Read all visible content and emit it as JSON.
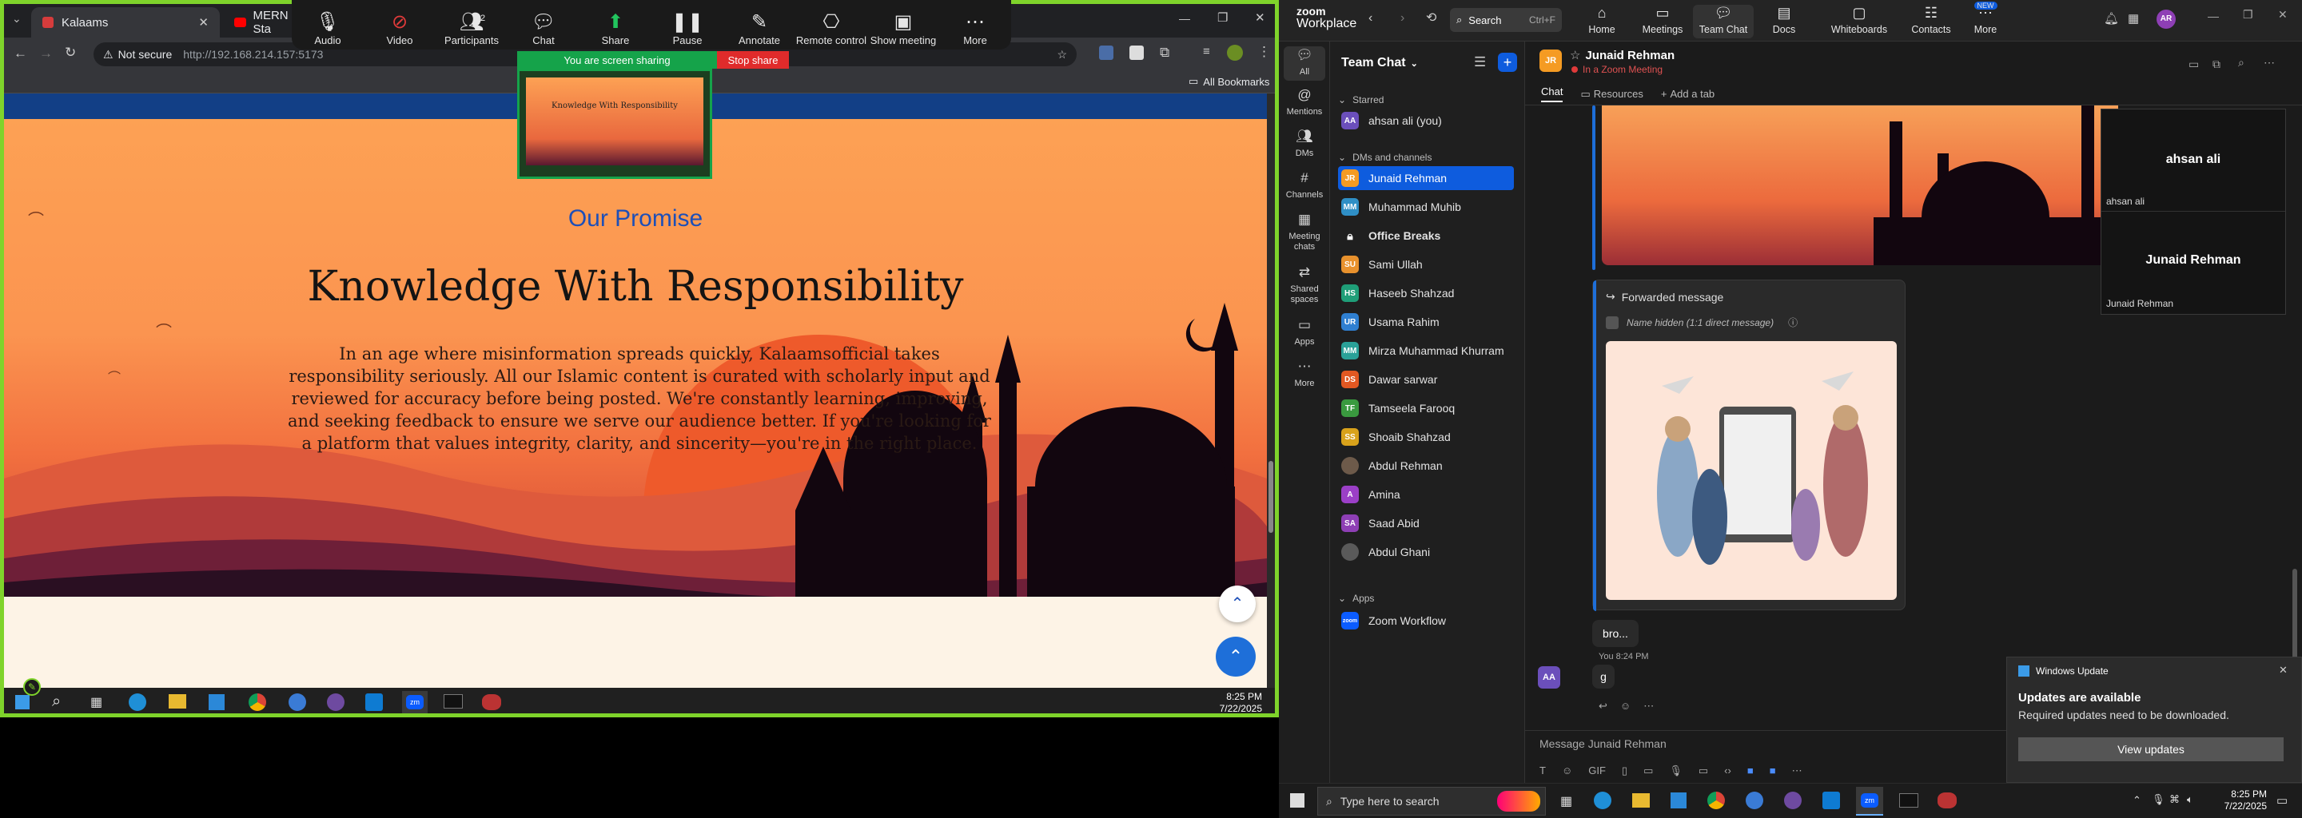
{
  "left_screen": {
    "browser": {
      "tabs": [
        {
          "label": "Kalaams",
          "active": true
        },
        {
          "label": "MERN Sta",
          "active": false
        }
      ],
      "security_label": "Not secure",
      "url": "http://192.168.214.157:5173",
      "bookmarks_label": "All Bookmarks"
    },
    "zoom_toolbar": {
      "participants_count": "2",
      "items": [
        {
          "label": "Audio",
          "icon": "microphone-icon"
        },
        {
          "label": "Video",
          "icon": "video-off-icon"
        },
        {
          "label": "Participants",
          "icon": "participants-icon"
        },
        {
          "label": "Chat",
          "icon": "chat-icon"
        },
        {
          "label": "Share",
          "icon": "share-screen-icon"
        },
        {
          "label": "Pause",
          "icon": "pause-icon"
        },
        {
          "label": "Annotate",
          "icon": "annotate-icon"
        },
        {
          "label": "Remote control",
          "icon": "remote-control-icon"
        },
        {
          "label": "Show meeting",
          "icon": "show-meeting-icon"
        },
        {
          "label": "More",
          "icon": "more-icon"
        }
      ],
      "sharing_label": "You are screen sharing",
      "stop_share_label": "Stop share",
      "preview_title": "Knowledge With Responsibility"
    },
    "page": {
      "section_label": "Our Promise",
      "heading": "Knowledge With Responsibility",
      "body": "In an age where misinformation spreads quickly, Kalaamsofficial takes responsibility seriously. All our Islamic content is curated with scholarly input and reviewed for accuracy before being posted. We're constantly learning, improving, and seeking feedback to ensure we serve our audience better. If you're looking for a platform that values integrity, clarity, and sincerity—you're in the right place."
    },
    "taskbar": {
      "time": "8:25 PM",
      "date": "7/22/2025"
    }
  },
  "right_screen": {
    "brand": {
      "line1": "zoom",
      "line2": "Workplace"
    },
    "search_label": "Search",
    "search_shortcut": "Ctrl+F",
    "nav": [
      {
        "label": "Home",
        "icon": "home-icon"
      },
      {
        "label": "Meetings",
        "icon": "meetings-icon"
      },
      {
        "label": "Team Chat",
        "icon": "team-chat-icon",
        "active": true
      },
      {
        "label": "Docs",
        "icon": "docs-icon"
      },
      {
        "label": "Whiteboards",
        "icon": "whiteboards-icon"
      },
      {
        "label": "Contacts",
        "icon": "contacts-icon"
      },
      {
        "label": "More",
        "icon": "more-icon",
        "badge": "NEW"
      }
    ],
    "user_initials": "AR",
    "rail": [
      {
        "label": "All",
        "icon": "chat-bubble-icon"
      },
      {
        "label": "Mentions",
        "icon": "mention-icon"
      },
      {
        "label": "DMs",
        "icon": "dm-icon"
      },
      {
        "label": "Channels",
        "icon": "channels-icon"
      },
      {
        "label": "Meeting chats",
        "icon": "meeting-chat-icon"
      },
      {
        "label": "Shared spaces",
        "icon": "shared-spaces-icon"
      },
      {
        "label": "Apps",
        "icon": "apps-icon"
      },
      {
        "label": "More",
        "icon": "more-dots-icon"
      }
    ],
    "chanlist": {
      "title": "Team Chat",
      "starred_label": "Starred",
      "starred": [
        {
          "name": "ahsan ali (you)",
          "initials": "AA",
          "color": "#6b4fbb"
        }
      ],
      "dms_label": "DMs and channels",
      "dms": [
        {
          "name": "Junaid Rehman",
          "initials": "JR",
          "color": "#f59b23",
          "selected": true
        },
        {
          "name": "Muhammad Muhib",
          "initials": "MM",
          "color": "#2f8fc6"
        },
        {
          "name": "Office Breaks",
          "initials": "",
          "color": "",
          "bold": true,
          "lock": true
        },
        {
          "name": "Sami Ullah",
          "initials": "SU",
          "color": "#e8912d"
        },
        {
          "name": "Haseeb Shahzad",
          "initials": "HS",
          "color": "#1f9e78"
        },
        {
          "name": "Usama Rahim",
          "initials": "UR",
          "color": "#2f7fd1"
        },
        {
          "name": "Mirza Muhammad Khurram",
          "initials": "MM",
          "color": "#2aa198"
        },
        {
          "name": "Dawar sarwar",
          "initials": "DS",
          "color": "#e25822"
        },
        {
          "name": "Tamseela Farooq",
          "initials": "TF",
          "color": "#3a9a3f"
        },
        {
          "name": "Shoaib Shahzad",
          "initials": "SS",
          "color": "#d8a21b"
        },
        {
          "name": "Abdul Rehman",
          "initials": "",
          "color": "#6d5a4a",
          "photo": true
        },
        {
          "name": "Amina",
          "initials": "A",
          "color": "#9b3fc7"
        },
        {
          "name": "Saad Abid",
          "initials": "SA",
          "color": "#8e3fb5"
        },
        {
          "name": "Abdul Ghani",
          "initials": "",
          "color": "#5a5a5a",
          "photo": true
        }
      ],
      "apps_label": "Apps",
      "apps": [
        {
          "name": "Zoom Workflow",
          "initials": "zoom",
          "color": "#0b5cff"
        }
      ]
    },
    "chat": {
      "contact_name": "Junaid Rehman",
      "contact_status": "In a Zoom Meeting",
      "tabs": [
        {
          "label": "Chat",
          "active": true
        },
        {
          "label": "Resources"
        },
        {
          "label": "Add a tab"
        }
      ],
      "forwarded_label": "Forwarded message",
      "name_hidden_label": "Name hidden (1:1 direct message)",
      "reply_text": "bro...",
      "my_meta": "You 8:24 PM",
      "my_initials": "AA",
      "my_text": "g",
      "input_placeholder": "Message Junaid Rehman"
    },
    "video_tiles": [
      {
        "big_name": "ahsan ali",
        "small_name": "ahsan ali"
      },
      {
        "big_name": "Junaid Rehman",
        "small_name": "Junaid Rehman"
      }
    ],
    "update_toast": {
      "header": "Windows Update",
      "title": "Updates are available",
      "body": "Required updates need to be downloaded.",
      "button": "View updates"
    },
    "taskbar": {
      "search_placeholder": "Type here to search",
      "time": "8:25 PM",
      "date": "7/22/2025"
    }
  },
  "colors": {
    "share_border": "#7fd32b",
    "zoom_blue": "#0e5cde",
    "hero_orange": "#fb9450",
    "heading_blue": "#1d4fb8"
  }
}
